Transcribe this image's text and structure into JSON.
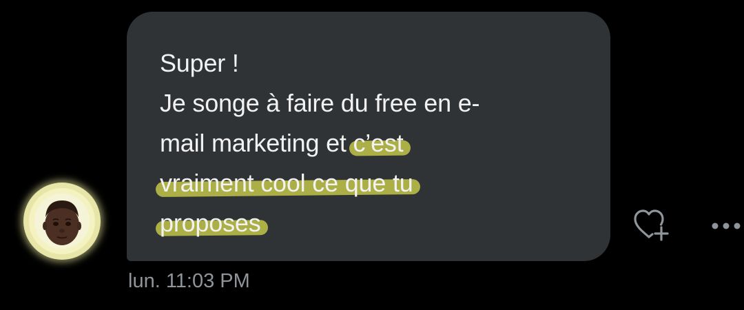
{
  "message": {
    "line1": "Super !",
    "line2": "Je songe à faire du free en e-",
    "line3_plain": "mail marketing et ",
    "line3_highlight": "c’est",
    "line4_highlight": "vraiment cool ce que tu",
    "line5_highlight": "proposes",
    "timestamp": "lun. 11:03 PM"
  },
  "icons": {
    "avatar": "memoji-avatar",
    "react": "heart-plus-icon",
    "more": "more-horizontal-icon"
  },
  "colors": {
    "background": "#000000",
    "bubble": "#2f3336",
    "text": "#f2f2f2",
    "timestamp": "#8f959a",
    "highlight": "#cfd24a",
    "avatar_ring": "#e7e6a8"
  }
}
